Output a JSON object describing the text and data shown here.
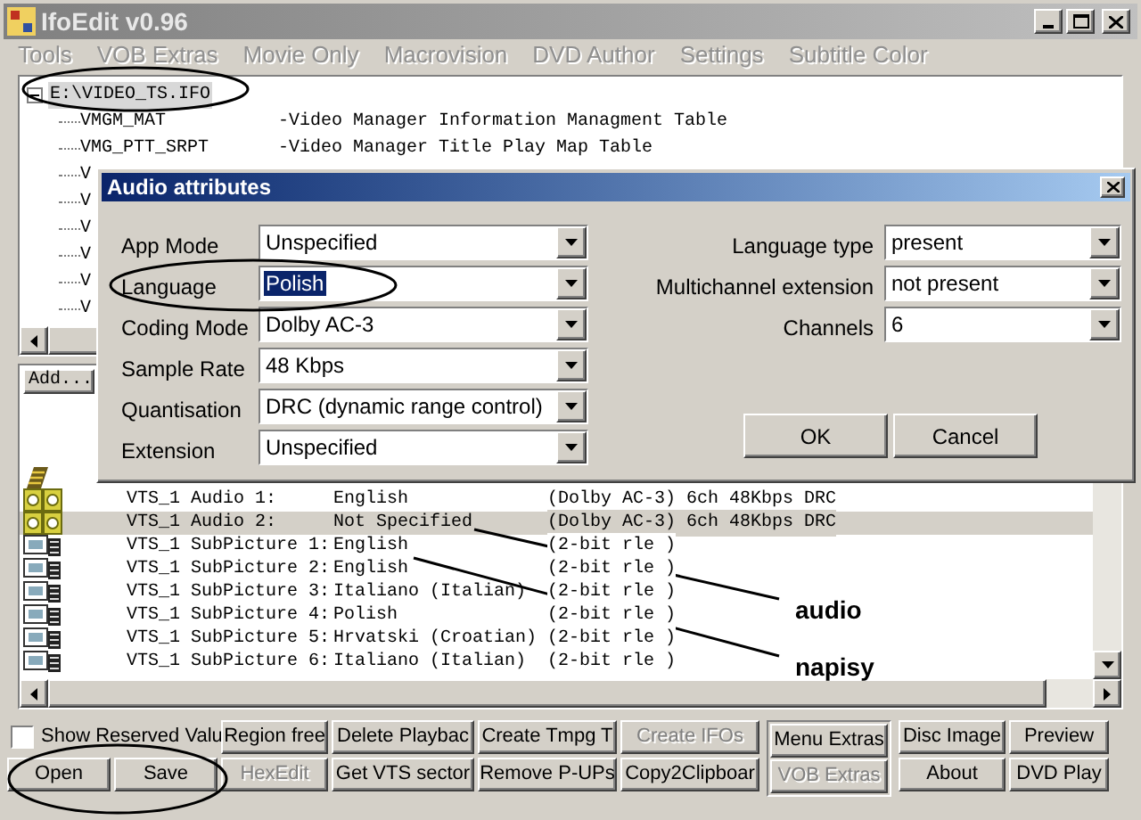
{
  "window": {
    "title": "IfoEdit v0.96"
  },
  "menu": [
    {
      "label": "Tools",
      "disabled": true
    },
    {
      "label": "VOB Extras",
      "disabled": true
    },
    {
      "label": "Movie Only",
      "disabled": true
    },
    {
      "label": "Macrovision",
      "disabled": true
    },
    {
      "label": "DVD Author",
      "disabled": true
    },
    {
      "label": "Settings",
      "disabled": true
    },
    {
      "label": "Subtitle Color",
      "disabled": true
    }
  ],
  "tree": {
    "root": {
      "label": "E:\\VIDEO_TS.IFO",
      "expanded": true,
      "selected": true,
      "children": [
        {
          "label": "VMGM_MAT",
          "description": "-Video Manager Information Managment Table",
          "selected": false
        },
        {
          "label": "VMG_PTT_SRPT",
          "description": "-Video Manager Title Play Map Table",
          "selected": false
        },
        {
          "label": "V",
          "selected": false
        },
        {
          "label": "V",
          "selected": false
        },
        {
          "label": "V",
          "selected": false
        },
        {
          "label": "V",
          "selected": false
        },
        {
          "label": "V",
          "selected": false
        },
        {
          "label": "V",
          "selected": false
        }
      ]
    }
  },
  "list": {
    "header": "Add...",
    "rows": [
      {
        "kind": "video",
        "selected": false
      },
      {
        "kind": "audio",
        "name": "VTS_1 Audio 1:",
        "value": "English",
        "format": "(Dolby AC-3) 6ch 48Kbps DRC",
        "selected": false
      },
      {
        "kind": "audio",
        "name": "VTS_1 Audio 2:",
        "value": "Not Specified",
        "format": "(Dolby AC-3) 6ch 48Kbps DRC",
        "selected": true
      },
      {
        "kind": "subpicture",
        "name": "VTS_1 SubPicture 1:",
        "value": "English",
        "format": "(2-bit rle )",
        "selected": false
      },
      {
        "kind": "subpicture",
        "name": "VTS_1 SubPicture 2:",
        "value": "English",
        "format": "(2-bit rle )",
        "selected": false
      },
      {
        "kind": "subpicture",
        "name": "VTS_1 SubPicture 3:",
        "value": "Italiano (Italian)",
        "format": "(2-bit rle )",
        "selected": false
      },
      {
        "kind": "subpicture",
        "name": "VTS_1 SubPicture 4:",
        "value": "Polish",
        "format": "(2-bit rle )",
        "selected": false
      },
      {
        "kind": "subpicture",
        "name": "VTS_1 SubPicture 5:",
        "value": "Hrvatski (Croatian)",
        "format": "(2-bit rle )",
        "selected": false
      },
      {
        "kind": "subpicture",
        "name": "VTS_1 SubPicture 6:",
        "value": "Italiano (Italian)",
        "format": "(2-bit rle )",
        "selected": false
      }
    ]
  },
  "show_reserved": {
    "label": "Show Reserved Valu",
    "checked": false
  },
  "button_columns": [
    [
      {
        "label": "Open",
        "disabled": false
      },
      {
        "label": "Save",
        "disabled": false
      }
    ],
    [
      {
        "label": "Region free",
        "disabled": false
      },
      {
        "label": "HexEdit",
        "disabled": true
      }
    ],
    [
      {
        "label": "Delete Playbac",
        "disabled": false
      },
      {
        "label": "Get VTS sector",
        "disabled": false
      }
    ],
    [
      {
        "label": "Create Tmpg T",
        "disabled": false
      },
      {
        "label": "Remove P-UPs",
        "disabled": false
      }
    ],
    [
      {
        "label": "Create IFOs",
        "disabled": true
      },
      {
        "label": "Copy2Clipboar",
        "disabled": false
      }
    ],
    [
      {
        "label": "Menu Extras",
        "disabled": false
      },
      {
        "label": "VOB Extras",
        "disabled": true
      }
    ],
    [
      {
        "label": "Disc Image",
        "disabled": false
      },
      {
        "label": "About",
        "disabled": false
      }
    ],
    [
      {
        "label": "Preview",
        "disabled": false
      },
      {
        "label": "DVD Play",
        "disabled": false
      }
    ]
  ],
  "dialog": {
    "title": "Audio attributes",
    "left_fields": [
      {
        "label": "App Mode",
        "value": "Unspecified",
        "highlighted": false
      },
      {
        "label": "Language",
        "value": "Polish",
        "highlighted": true
      },
      {
        "label": "Coding Mode",
        "value": "Dolby AC-3",
        "highlighted": false
      },
      {
        "label": "Sample Rate",
        "value": "48 Kbps",
        "highlighted": false
      },
      {
        "label": "Quantisation",
        "value": "DRC (dynamic range control)",
        "highlighted": false
      },
      {
        "label": "Extension",
        "value": "Unspecified",
        "highlighted": false
      }
    ],
    "right_fields": [
      {
        "label": "Language type",
        "value": "present",
        "highlighted": false
      },
      {
        "label": "Multichannel extension",
        "value": "not present",
        "highlighted": false
      },
      {
        "label": "Channels",
        "value": "6",
        "highlighted": false
      }
    ],
    "buttons": [
      "OK",
      "Cancel"
    ]
  },
  "annotations": [
    "audio",
    "napisy"
  ]
}
